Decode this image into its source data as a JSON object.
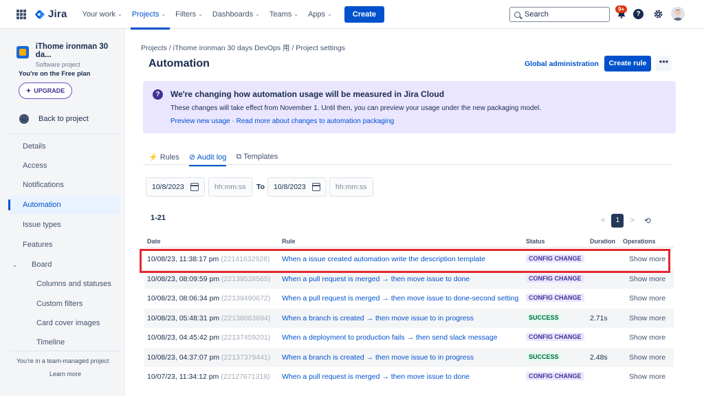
{
  "topnav": {
    "logo": "Jira",
    "items": [
      {
        "label": "Your work",
        "caret": true
      },
      {
        "label": "Projects",
        "caret": true,
        "active": true
      },
      {
        "label": "Filters",
        "caret": true
      },
      {
        "label": "Dashboards",
        "caret": true
      },
      {
        "label": "Teams",
        "caret": true
      },
      {
        "label": "Apps",
        "caret": true
      }
    ],
    "create_label": "Create",
    "search_placeholder": "Search",
    "notifications_badge": "9+",
    "help_label": "?"
  },
  "sidebar": {
    "project_name": "iThome ironman 30 da...",
    "project_type": "Software project",
    "plan_text": "You're on the Free plan",
    "upgrade_label": "UPGRADE",
    "back_label": "Back to project",
    "items": [
      {
        "label": "Details"
      },
      {
        "label": "Access"
      },
      {
        "label": "Notifications"
      },
      {
        "label": "Automation",
        "active": true
      },
      {
        "label": "Issue types"
      },
      {
        "label": "Features"
      },
      {
        "label": "Board",
        "expandable": true
      },
      {
        "label": "Columns and statuses",
        "sub": true
      },
      {
        "label": "Custom filters",
        "sub": true
      },
      {
        "label": "Card cover images",
        "sub": true
      },
      {
        "label": "Timeline",
        "sub": true
      }
    ],
    "team_managed_text": "You're in a team-managed project",
    "learn_more": "Learn more"
  },
  "main": {
    "breadcrumb": "Projects  /  iThome ironman 30 days DevOps 用  /  Project settings",
    "title": "Automation",
    "global_admin": "Global administration",
    "create_rule": "Create rule",
    "more": "•••",
    "banner": {
      "title": "We're changing how automation usage will be measured in Jira Cloud",
      "body": "These changes will take effect from November 1. Until then, you can preview your usage under the new packaging model.",
      "link1": "Preview new usage",
      "separator": " · ",
      "link2": "Read more about changes to automation packaging"
    },
    "tabs": [
      {
        "label": "Rules",
        "icon": "lightning-icon"
      },
      {
        "label": "Audit log",
        "icon": "check-circle-icon",
        "active": true
      },
      {
        "label": "Templates",
        "icon": "copy-icon"
      }
    ],
    "filter": {
      "from_date": "10/8/2023",
      "from_time_placeholder": "hh:mm:ss",
      "to_label": "To",
      "to_date": "10/8/2023",
      "to_time_placeholder": "hh:mm:ss"
    },
    "range": "1-21",
    "pager": {
      "prev": "<",
      "current": "1",
      "next": ">"
    },
    "table": {
      "headers": [
        "Date",
        "Rule",
        "Status",
        "Duration",
        "Operations"
      ],
      "rows": [
        {
          "date": "10/08/23, 11:38:17 pm",
          "id": "(22141632928)",
          "rule": "When a issue created automation write the description template",
          "status": "CONFIG CHANGE",
          "status_type": "config",
          "duration": "",
          "op": "Show more"
        },
        {
          "date": "10/08/23, 08:09:59 pm",
          "id": "(22139528565)",
          "rule": "When a pull request is merged → then move issue to done",
          "status": "CONFIG CHANGE",
          "status_type": "config",
          "duration": "",
          "op": "Show more"
        },
        {
          "date": "10/08/23, 08:06:34 pm",
          "id": "(22139490672)",
          "rule": "When a pull request is merged → then move issue to done-second setting",
          "status": "CONFIG CHANGE",
          "status_type": "config",
          "duration": "",
          "op": "Show more"
        },
        {
          "date": "10/08/23, 05:48:31 pm",
          "id": "(22138083694)",
          "rule": "When a branch is created → then move issue to in progress",
          "status": "SUCCESS",
          "status_type": "success",
          "duration": "2.71s",
          "op": "Show more"
        },
        {
          "date": "10/08/23, 04:45:42 pm",
          "id": "(22137459201)",
          "rule": "When a deployment to production fails → then send slack message",
          "status": "CONFIG CHANGE",
          "status_type": "config",
          "duration": "",
          "op": "Show more"
        },
        {
          "date": "10/08/23, 04:37:07 pm",
          "id": "(22137379441)",
          "rule": "When a branch is created → then move issue to in progress",
          "status": "SUCCESS",
          "status_type": "success",
          "duration": "2.48s",
          "op": "Show more"
        },
        {
          "date": "10/07/23, 11:34:12 pm",
          "id": "(22127671318)",
          "rule": "When a pull request is merged → then move issue to done",
          "status": "CONFIG CHANGE",
          "status_type": "config",
          "duration": "",
          "op": "Show more"
        }
      ]
    }
  },
  "colors": {
    "accent": "#0052cc",
    "highlight": "#e5252f",
    "banner_bg": "#eae6ff"
  }
}
